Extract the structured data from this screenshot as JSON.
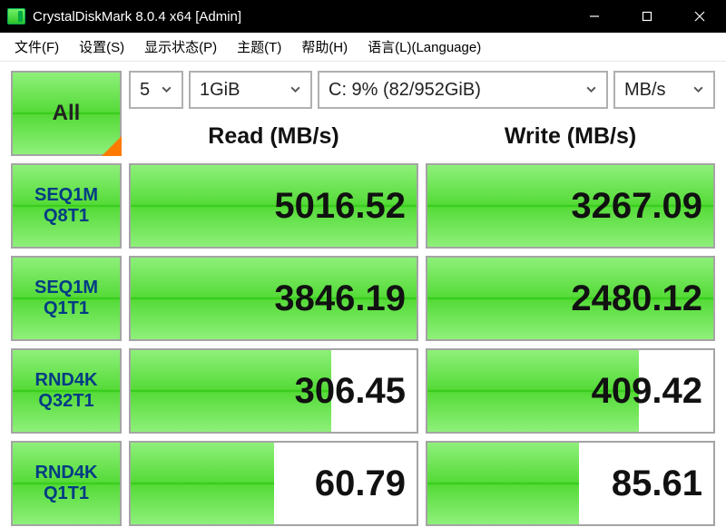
{
  "window": {
    "title": "CrystalDiskMark 8.0.4 x64 [Admin]"
  },
  "menu": {
    "file": "文件(F)",
    "settings": "设置(S)",
    "state": "显示状态(P)",
    "theme": "主题(T)",
    "help": "帮助(H)",
    "lang": "语言(L)(Language)"
  },
  "controls": {
    "iterations": "5",
    "size": "1GiB",
    "drive": "C: 9% (82/952GiB)",
    "unit": "MB/s"
  },
  "buttons": {
    "all": "All"
  },
  "headers": {
    "read": "Read (MB/s)",
    "write": "Write (MB/s)"
  },
  "tests": [
    {
      "line1": "SEQ1M",
      "line2": "Q8T1",
      "read": "5016.52",
      "write": "3267.09",
      "read_pct": 100,
      "write_pct": 100
    },
    {
      "line1": "SEQ1M",
      "line2": "Q1T1",
      "read": "3846.19",
      "write": "2480.12",
      "read_pct": 100,
      "write_pct": 100
    },
    {
      "line1": "RND4K",
      "line2": "Q32T1",
      "read": "306.45",
      "write": "409.42",
      "read_pct": 70,
      "write_pct": 74
    },
    {
      "line1": "RND4K",
      "line2": "Q1T1",
      "read": "60.79",
      "write": "85.61",
      "read_pct": 50,
      "write_pct": 53
    }
  ]
}
